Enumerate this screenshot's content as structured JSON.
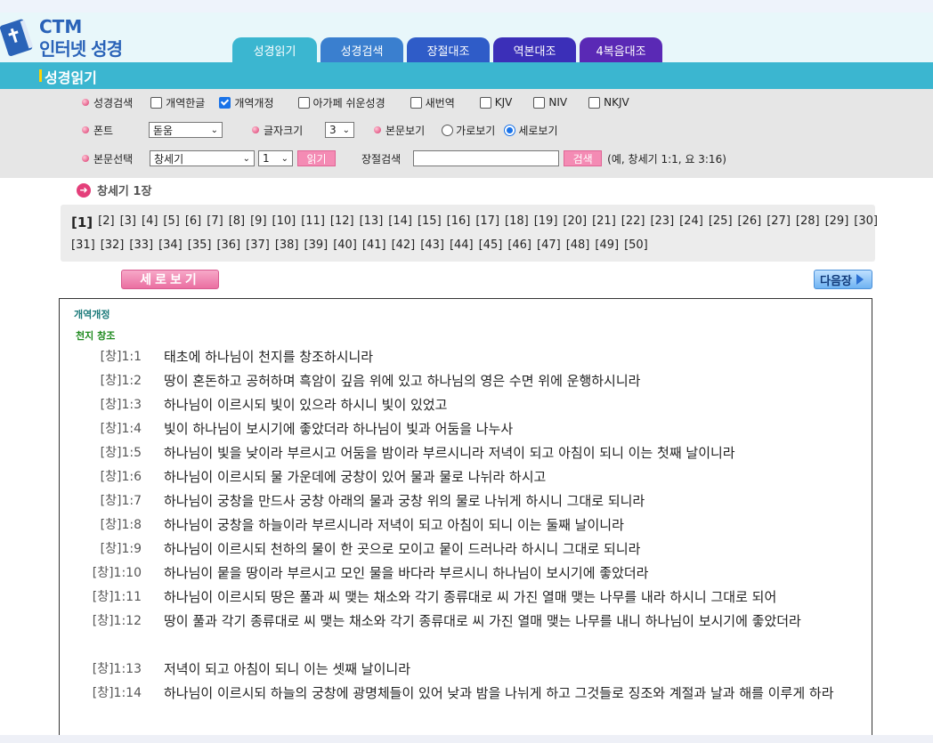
{
  "logo": {
    "line1": "CTM",
    "line2": "인터넷 성경"
  },
  "tabs": [
    "성경읽기",
    "성경검색",
    "장절대조",
    "역본대조",
    "4복음대조"
  ],
  "section_title": "성경읽기",
  "options": {
    "versions_label": "성경검색",
    "versions": [
      {
        "label": "개역한글",
        "checked": false
      },
      {
        "label": "개역개정",
        "checked": true
      },
      {
        "label": "아가페 쉬운성경",
        "checked": false
      },
      {
        "label": "새번역",
        "checked": false
      },
      {
        "label": "KJV",
        "checked": false
      },
      {
        "label": "NIV",
        "checked": false
      },
      {
        "label": "NKJV",
        "checked": false
      }
    ],
    "font_label": "폰트",
    "font_value": "돋움",
    "size_label": "글자크기",
    "size_value": "3",
    "view_label": "본문보기",
    "view_horizontal": "가로보기",
    "view_vertical": "세로보기",
    "view_selected": "vertical",
    "select_label": "본문선택",
    "book_value": "창세기",
    "chapter_value": "1",
    "read_button": "읽기",
    "search_label": "장절검색",
    "search_value": "",
    "search_button": "검색",
    "search_example": "(예, 창세기 1:1, 요 3:16)"
  },
  "chapter_title": "창세기 1장",
  "chapters_row1": [
    "[1]",
    "[2]",
    "[3]",
    "[4]",
    "[5]",
    "[6]",
    "[7]",
    "[8]",
    "[9]",
    "[10]",
    "[11]",
    "[12]",
    "[13]",
    "[14]",
    "[15]",
    "[16]",
    "[17]",
    "[18]",
    "[19]",
    "[20]",
    "[21]",
    "[22]",
    "[23]",
    "[24]",
    "[25]",
    "[26]",
    "[27]",
    "[28]",
    "[29]",
    "[30]"
  ],
  "chapters_row2": [
    "[31]",
    "[32]",
    "[33]",
    "[34]",
    "[35]",
    "[36]",
    "[37]",
    "[38]",
    "[39]",
    "[40]",
    "[41]",
    "[42]",
    "[43]",
    "[44]",
    "[45]",
    "[46]",
    "[47]",
    "[48]",
    "[49]",
    "[50]"
  ],
  "current_chapter": "[1]",
  "vertical_button": "세로보기",
  "next_button": "다음장",
  "text": {
    "version": "개역개정",
    "heading": "천지 창조",
    "verses": [
      {
        "ref": "[창]1:1",
        "text": "태초에 하나님이 천지를 창조하시니라"
      },
      {
        "ref": "[창]1:2",
        "text": "땅이 혼돈하고 공허하며 흑암이 깊음 위에 있고 하나님의 영은 수면 위에 운행하시니라"
      },
      {
        "ref": "[창]1:3",
        "text": "하나님이 이르시되 빛이 있으라 하시니 빛이 있었고"
      },
      {
        "ref": "[창]1:4",
        "text": "빛이 하나님이 보시기에 좋았더라 하나님이 빛과 어둠을 나누사"
      },
      {
        "ref": "[창]1:5",
        "text": "하나님이 빛을 낮이라 부르시고 어둠을 밤이라 부르시니라 저녁이 되고 아침이 되니 이는 첫째 날이니라"
      },
      {
        "ref": "[창]1:6",
        "text": "하나님이 이르시되 물 가운데에 궁창이 있어 물과 물로 나뉘라 하시고"
      },
      {
        "ref": "[창]1:7",
        "text": "하나님이 궁창을 만드사 궁창 아래의 물과 궁창 위의 물로 나뉘게 하시니 그대로 되니라"
      },
      {
        "ref": "[창]1:8",
        "text": "하나님이 궁창을 하늘이라 부르시니라 저녁이 되고 아침이 되니 이는 둘째 날이니라"
      },
      {
        "ref": "[창]1:9",
        "text": "하나님이 이르시되 천하의 물이 한 곳으로 모이고 뭍이 드러나라 하시니 그대로 되니라"
      },
      {
        "ref": "[창]1:10",
        "text": "하나님이 뭍을 땅이라 부르시고 모인 물을 바다라 부르시니 하나님이 보시기에 좋았더라"
      },
      {
        "ref": "[창]1:11",
        "text": "하나님이 이르시되 땅은 풀과 씨 맺는 채소와 각기 종류대로 씨 가진 열매 맺는 나무를 내라 하시니 그대로 되어"
      },
      {
        "ref": "[창]1:12",
        "text": "땅이 풀과 각기 종류대로 씨 맺는 채소와 각기 종류대로 씨 가진 열매 맺는 나무를 내니 하나님이 보시기에 좋았더라"
      },
      {
        "ref": "[창]1:13",
        "text": "저녁이 되고 아침이 되니 이는 셋째 날이니라"
      },
      {
        "ref": "[창]1:14",
        "text": "하나님이 이르시되 하늘의 궁창에 광명체들이 있어 낮과 밤을 나뉘게 하고 그것들로 징조와 계절과 날과 해를 이루게 하라"
      }
    ]
  }
}
